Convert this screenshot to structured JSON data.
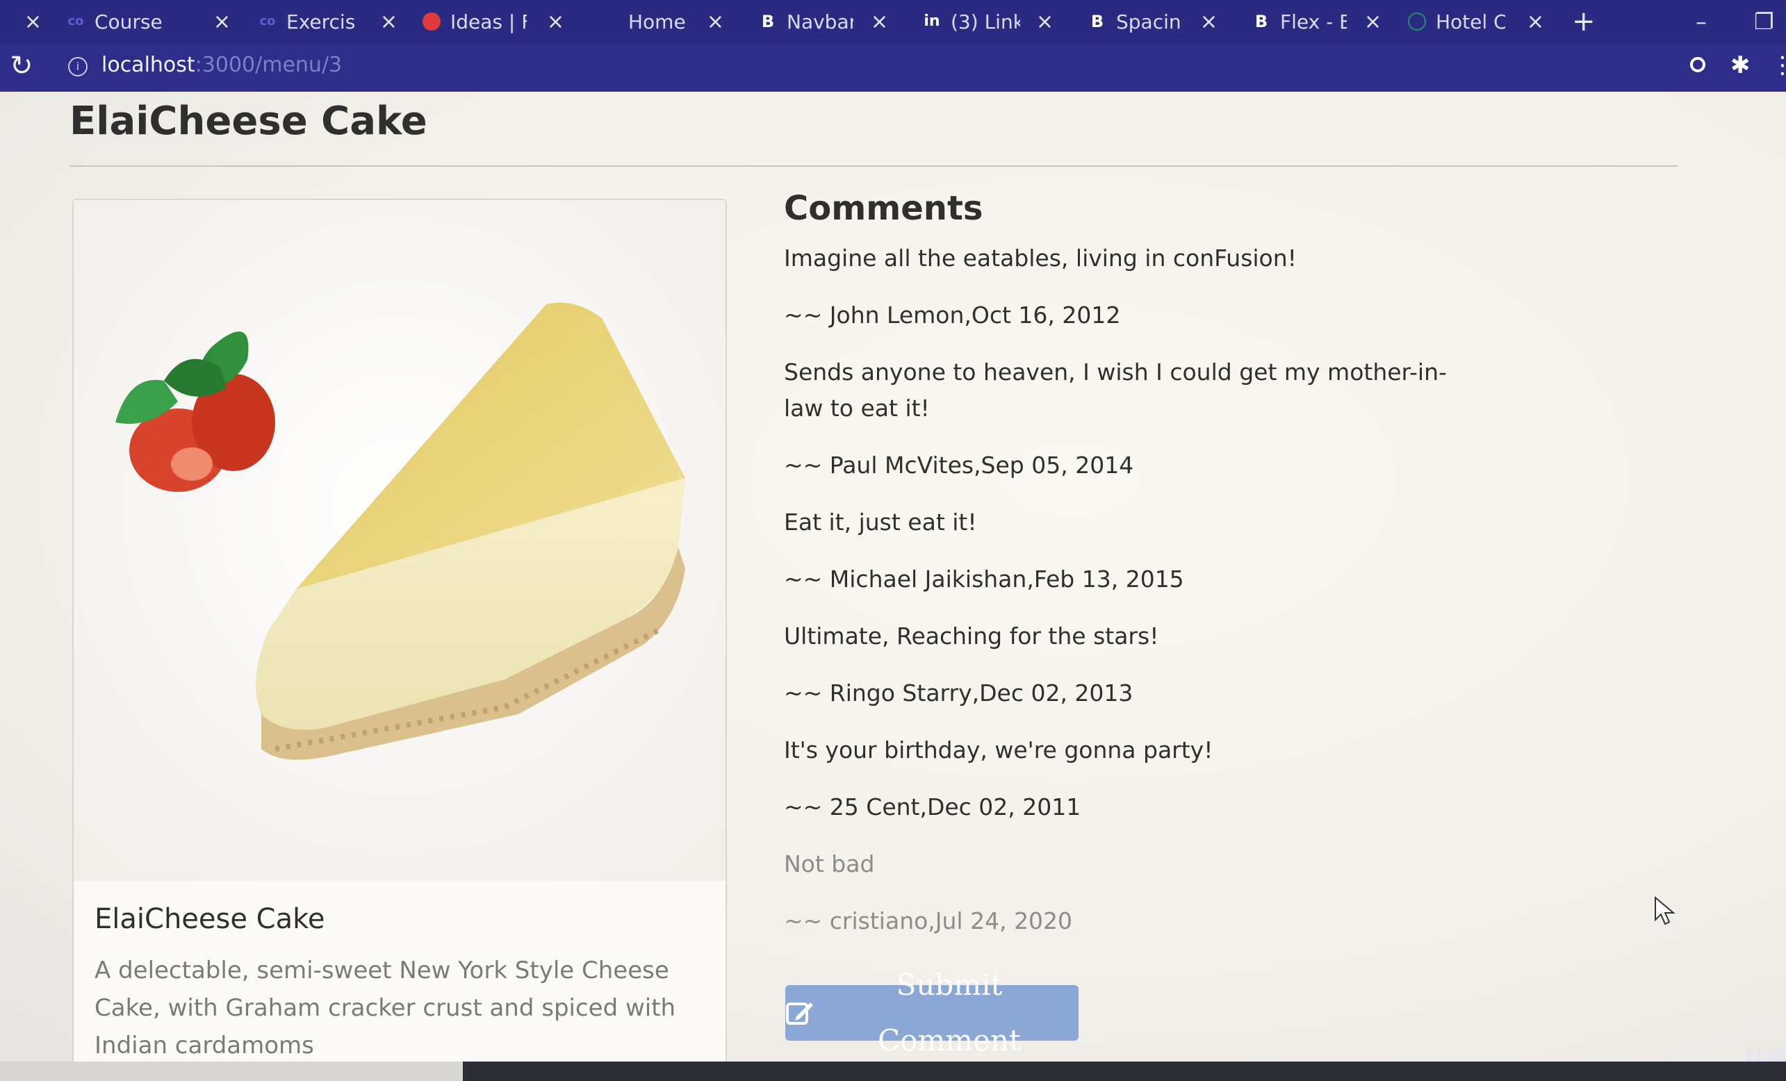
{
  "browser": {
    "tabs": [
      {
        "label": "Course",
        "icon": "coursera-icon",
        "icon_text": "co"
      },
      {
        "label": "Exercis",
        "icon": "coursera-icon",
        "icon_text": "co"
      },
      {
        "label": "Ideas | F",
        "icon": "tomato-icon",
        "icon_text": ""
      },
      {
        "label": "Home",
        "icon": "page-icon",
        "icon_text": ""
      },
      {
        "label": "Navbar",
        "icon": "bootstrap-icon",
        "icon_text": "B"
      },
      {
        "label": "(3) Link",
        "icon": "linkedin-icon",
        "icon_text": "in"
      },
      {
        "label": "Spacin",
        "icon": "bootstrap-icon",
        "icon_text": "B"
      },
      {
        "label": "Flex - B",
        "icon": "bootstrap-icon",
        "icon_text": "B"
      },
      {
        "label": "Hotel C",
        "icon": "globe-icon",
        "icon_text": ""
      }
    ],
    "url_host": "localhost",
    "url_path": ":3000/menu/3"
  },
  "page": {
    "title": "ElaiCheese Cake",
    "dish": {
      "name": "ElaiCheese Cake",
      "description": "A delectable, semi-sweet New York Style Cheese Cake, with Graham cracker crust and spiced with Indian cardamoms"
    },
    "comments_heading": "Comments",
    "comments": [
      {
        "text": "Imagine all the eatables, living in conFusion!",
        "byline": "~~ John Lemon,Oct 16, 2012"
      },
      {
        "text": "Sends anyone to heaven, I wish I could get my mother-in-law to eat it!",
        "byline": "~~ Paul McVites,Sep 05, 2014"
      },
      {
        "text": "Eat it, just eat it!",
        "byline": "~~ Michael Jaikishan,Feb 13, 2015"
      },
      {
        "text": "Ultimate, Reaching for the stars!",
        "byline": "~~ Ringo Starry,Dec 02, 2013"
      },
      {
        "text": "It's your birthday, we're gonna party!",
        "byline": "~~ 25 Cent,Dec 02, 2011"
      },
      {
        "text": "Not bad",
        "byline": "~~ cristiano,Jul 24, 2020"
      }
    ],
    "submit_label": "Submit Comment"
  },
  "taskbar": {
    "clock": "11:05"
  },
  "colors": {
    "chrome": "#2b2a83",
    "button": "#8aa7d6"
  }
}
